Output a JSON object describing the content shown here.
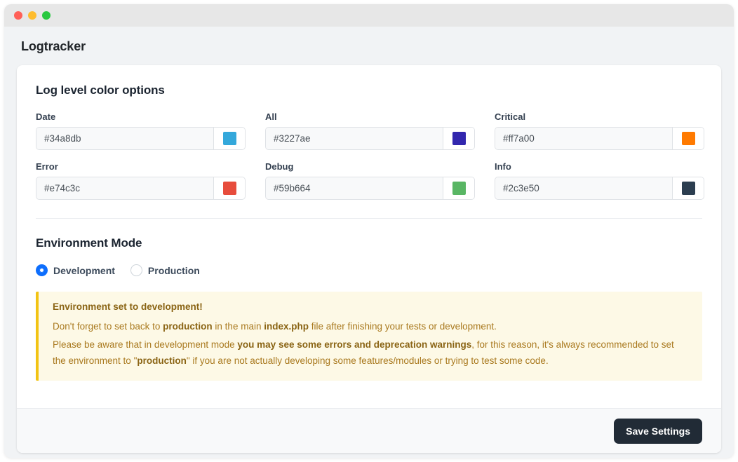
{
  "window": {
    "traffic_lights": [
      {
        "name": "close-button",
        "color": "#ff5f57"
      },
      {
        "name": "minimize-button",
        "color": "#febc2e"
      },
      {
        "name": "maximize-button",
        "color": "#28c840"
      }
    ]
  },
  "app": {
    "title": "Logtracker"
  },
  "colors_section": {
    "title": "Log level color options",
    "fields": [
      {
        "label": "Date",
        "value": "#34a8db",
        "swatch": "#34a8db"
      },
      {
        "label": "All",
        "value": "#3227ae",
        "swatch": "#3227ae"
      },
      {
        "label": "Critical",
        "value": "#ff7a00",
        "swatch": "#ff7a00"
      },
      {
        "label": "Error",
        "value": "#e74c3c",
        "swatch": "#e74c3c"
      },
      {
        "label": "Debug",
        "value": "#59b664",
        "swatch": "#59b664"
      },
      {
        "label": "Info",
        "value": "#2c3e50",
        "swatch": "#2c3e50"
      }
    ]
  },
  "environment_section": {
    "title": "Environment Mode",
    "options": [
      {
        "label": "Development",
        "selected": true
      },
      {
        "label": "Production",
        "selected": false
      }
    ],
    "alert": {
      "accent_color": "#f2c313",
      "background_color": "#fdf9e6",
      "title": "Environment set to development!",
      "line1_prefix": "Don't forget to set back to ",
      "line1_bold1": "production",
      "line1_middle": " in the main ",
      "line1_bold2": "index.php",
      "line1_suffix": " file after finishing your tests or development.",
      "line2_prefix": "Please be aware that in development mode ",
      "line2_bold1": "you may see some errors and deprecation warnings",
      "line2_middle": ", for this reason, it's always recommended to set the environment to \"",
      "line2_bold2": "production",
      "line2_suffix": "\" if you are not actually developing some features/modules or trying to test some code."
    }
  },
  "footer": {
    "save_label": "Save Settings"
  }
}
